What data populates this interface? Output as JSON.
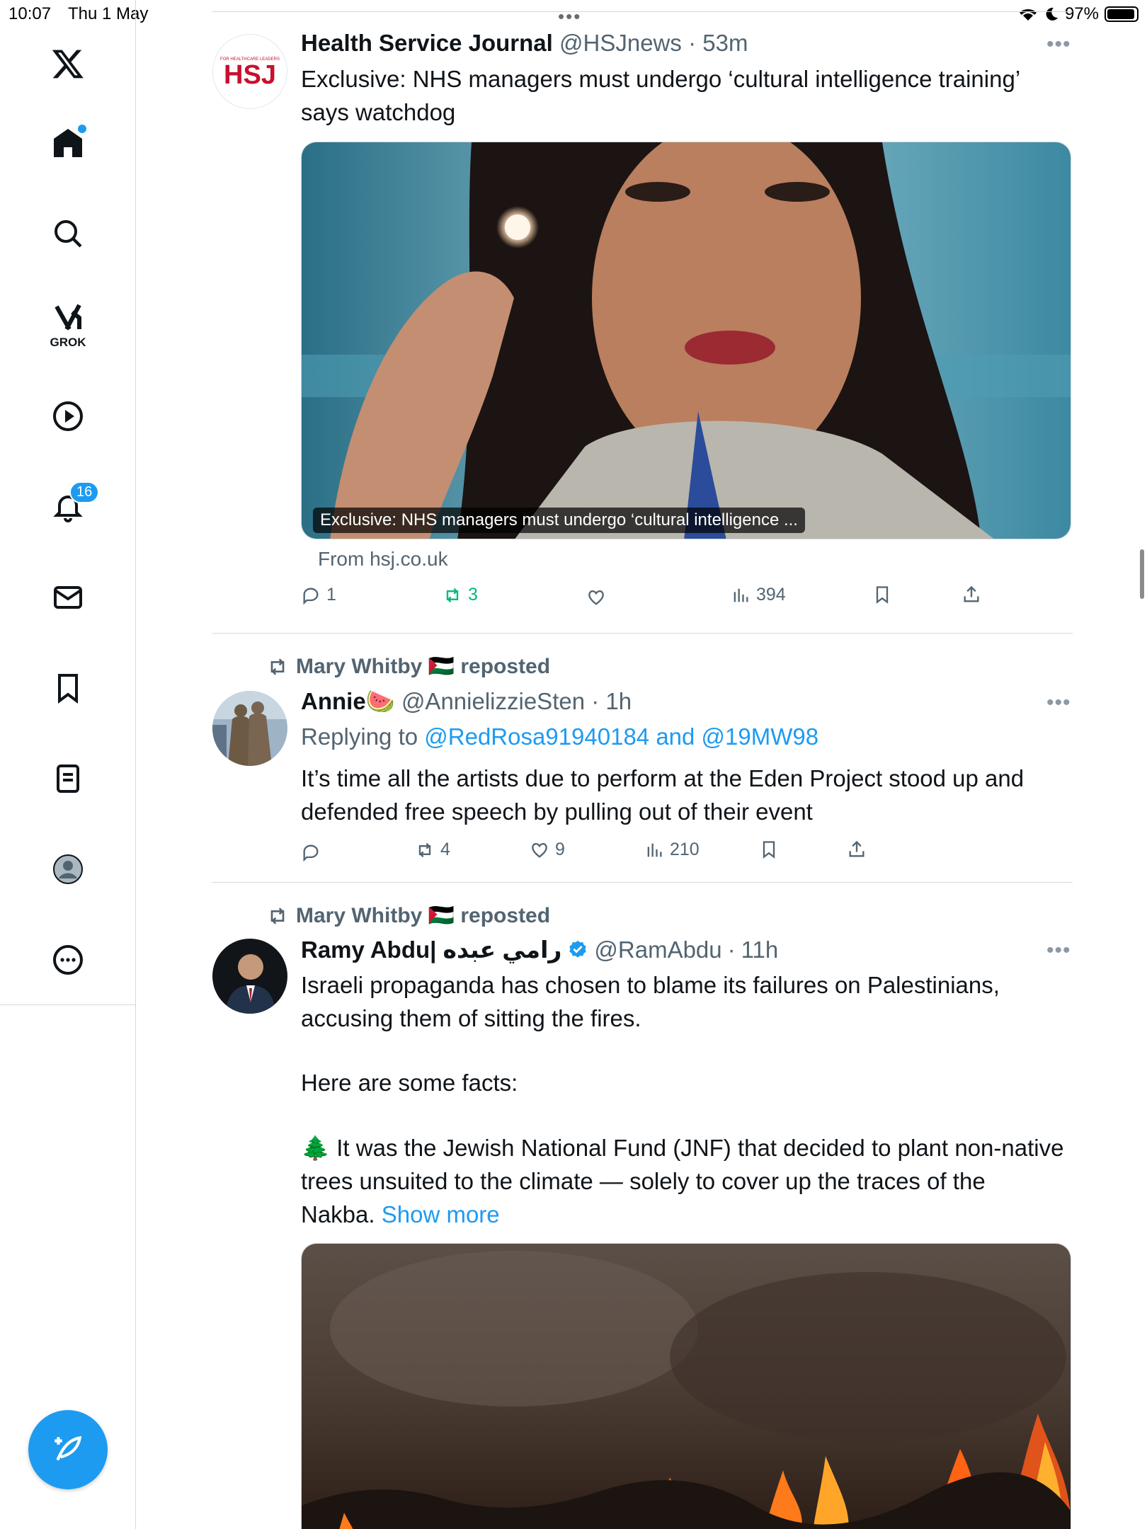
{
  "status_bar": {
    "time": "10:07",
    "date": "Thu 1 May",
    "battery": "97%",
    "dots": "•••"
  },
  "sidebar": {
    "grok_label": "GROK",
    "notifications_count": "16"
  },
  "tweets": [
    {
      "name": "Health Service Journal",
      "handle": "@HSJnews",
      "time": "53m",
      "avatar_text": "HSJ",
      "avatar_subtext": "FOR HEALTHCARE LEADERS",
      "text": "Exclusive: NHS managers must undergo ‘cultural intelligence training’ says watchdog",
      "card_caption": "Exclusive: NHS managers must undergo ‘cultural intelligence ...",
      "card_source": "From hsj.co.uk",
      "replies": "1",
      "reposts": "3",
      "likes": "",
      "views": "394"
    },
    {
      "reposted_by": "Mary Whitby 🇵🇸 reposted",
      "name": "Annie🍉",
      "handle": "@AnnielizzieSten",
      "time": "1h",
      "replying_prefix": "Replying to ",
      "replying_to": "@RedRosa91940184 and @19MW98",
      "text": "It’s time all the artists due to perform at the Eden Project stood up and defended free speech by pulling out of their event",
      "replies": "",
      "reposts": "4",
      "likes": "9",
      "views": "210"
    },
    {
      "reposted_by": "Mary Whitby 🇵🇸 reposted",
      "name": "Ramy Abdu| رامي عبده",
      "handle": "@RamAbdu",
      "time": "11h",
      "text_p1": "Israeli propaganda has chosen to blame its failures on Palestinians, accusing them of sitting the fires.",
      "text_p2": "Here are some facts:",
      "text_p3": "🌲 It was the Jewish National Fund (JNF) that decided to plant non-native trees unsuited to the climate — solely to cover up the traces of the Nakba.",
      "show_more": "Show more"
    }
  ],
  "colors": {
    "accent": "#1d9bf0",
    "repost_green": "#00ba7c",
    "muted": "#536471"
  }
}
